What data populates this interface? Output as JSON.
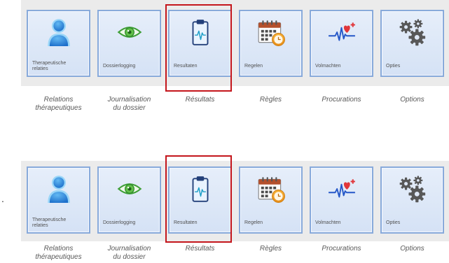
{
  "colors": {
    "highlight": "#c4161c",
    "tile_border": "#88aadb",
    "tile_bar_background": "#ebebeb"
  },
  "rows": [
    {
      "tiles": [
        {
          "icon": "person-icon",
          "label": "Therapeutische\nrelaties",
          "caption": "Relations\nthérapeutiques",
          "highlighted": false
        },
        {
          "icon": "eye-icon",
          "label": "Dossierlogging",
          "caption": "Journalisation\ndu dossier",
          "highlighted": false
        },
        {
          "icon": "clipboard-heartbeat-icon",
          "label": "Resultaten",
          "caption": "Résultats",
          "highlighted": true
        },
        {
          "icon": "calendar-clock-icon",
          "label": "Regelen",
          "caption": "Règles",
          "highlighted": false
        },
        {
          "icon": "heartbeat-heart-icon",
          "label": "Volmachten",
          "caption": "Procurations",
          "highlighted": false
        },
        {
          "icon": "gears-icon",
          "label": "Opties",
          "caption": "Options",
          "highlighted": false
        }
      ]
    },
    {
      "marker": ".",
      "tiles": [
        {
          "icon": "person-icon",
          "label": "Therapeutische\nrelaties",
          "caption": "Relations\nthérapeutiques",
          "highlighted": false
        },
        {
          "icon": "eye-icon",
          "label": "Dossierlogging",
          "caption": "Journalisation\ndu dossier",
          "highlighted": false
        },
        {
          "icon": "clipboard-heartbeat-icon",
          "label": "Resultaten",
          "caption": "Résultats",
          "highlighted": true
        },
        {
          "icon": "calendar-clock-icon",
          "label": "Regelen",
          "caption": "Règles",
          "highlighted": false
        },
        {
          "icon": "heartbeat-heart-icon",
          "label": "Volmachten",
          "caption": "Procurations",
          "highlighted": false
        },
        {
          "icon": "gears-icon",
          "label": "Opties",
          "caption": "Options",
          "highlighted": false
        }
      ]
    }
  ]
}
